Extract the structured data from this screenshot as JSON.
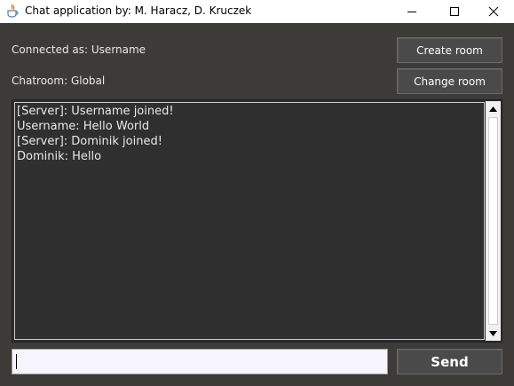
{
  "window": {
    "title": "Chat application by: M. Haracz, D. Kruczek",
    "controls": [
      "minimize-icon",
      "maximize-icon",
      "close-icon"
    ]
  },
  "status": {
    "connected_as": "Connected as: Username",
    "chatroom": "Chatroom: Global"
  },
  "buttons": {
    "create_room": "Create room",
    "change_room": "Change room",
    "send": "Send"
  },
  "messages": [
    "[Server]: Username joined!",
    "Username: Hello World",
    "[Server]: Dominik joined!",
    "Dominik: Hello"
  ],
  "message_input": {
    "value": ""
  },
  "colors": {
    "background": "#3c3b37",
    "chat_background": "#2f2f2f",
    "button_background": "#4a4a4a",
    "text": "#e8e8e8"
  }
}
